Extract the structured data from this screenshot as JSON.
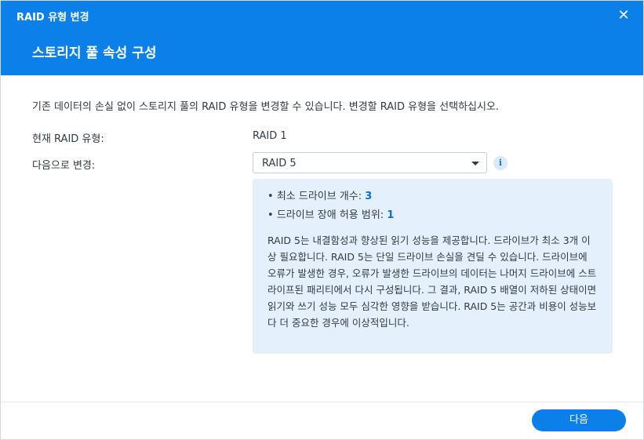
{
  "window": {
    "title": "RAID 유형 변경",
    "close_glyph": "✕"
  },
  "header": {
    "subtitle": "스토리지 풀 속성 구성"
  },
  "main": {
    "description": "기존 데이터의 손실 없이 스토리지 풀의 RAID 유형을 변경할 수 있습니다. 변경할 RAID 유형을 선택하십시오.",
    "current_label": "현재 RAID 유형:",
    "current_value": "RAID 1",
    "change_label": "다음으로 변경:",
    "select_value": "RAID 5",
    "info_icon_glyph": "i"
  },
  "info_panel": {
    "min_drives_label": "최소 드라이브 개수:",
    "min_drives_value": "3",
    "fault_tolerance_label": "드라이브 장애 허용 범위:",
    "fault_tolerance_value": "1",
    "description": "RAID 5는 내결함성과 향상된 읽기 성능을 제공합니다. 드라이브가 최소 3개 이상 필요합니다. RAID 5는 단일 드라이브 손실을 견딜 수 있습니다. 드라이브에 오류가 발생한 경우, 오류가 발생한 드라이브의 데이터는 나머지 드라이브에 스트라이프된 패리티에서 다시 구성됩니다. 그 결과, RAID 5 배열이 저하된 상태이면 읽기와 쓰기 성능 모두 심각한 영향을 받습니다. RAID 5는 공간과 비용이 성능보다 더 중요한 경우에 이상적입니다."
  },
  "footer": {
    "next_label": "다음"
  },
  "colors": {
    "accent": "#0a80e8",
    "panel_bg": "#e4f0fc",
    "value_text": "#0a6fd0"
  },
  "icons": [
    "close-icon",
    "info-icon",
    "chevron-down-icon"
  ]
}
